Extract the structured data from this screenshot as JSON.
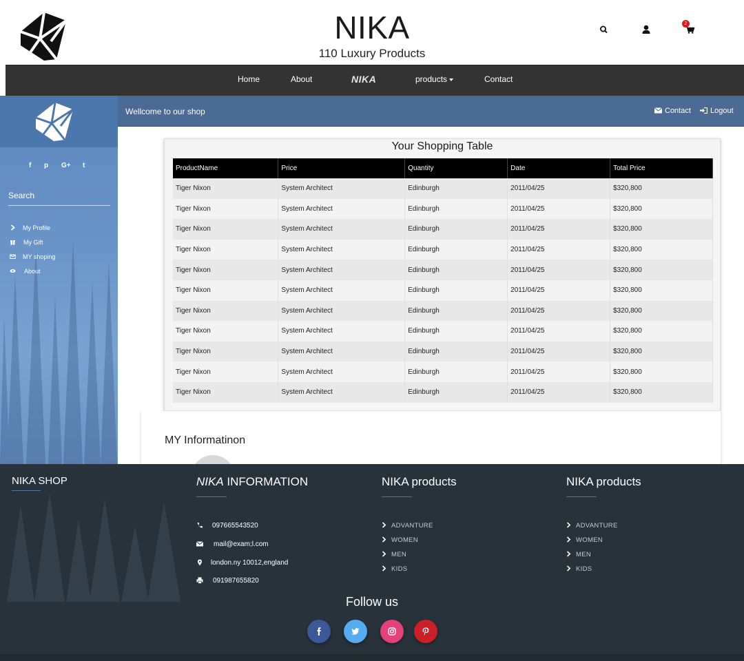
{
  "header": {
    "brand_title": "NIKA",
    "brand_subtitle": "110 Luxury Products",
    "cart_count": "2",
    "icons": [
      "logo-icon",
      "search-icon",
      "user-icon",
      "cart-icon"
    ]
  },
  "nav": {
    "items": [
      "Home",
      "About",
      "NIKA",
      "products",
      "Contact"
    ]
  },
  "sidebar": {
    "social": [
      "f",
      "p",
      "G+",
      "t"
    ],
    "search_label": "Search",
    "menu": [
      {
        "label": "My Profile",
        "icon": "chevron-right-icon"
      },
      {
        "label": "My Gift",
        "icon": "gift-icon"
      },
      {
        "label": "MY shoping",
        "icon": "envelope-icon"
      },
      {
        "label": "About",
        "icon": "eye-icon"
      }
    ]
  },
  "welcome": {
    "text": "Wellcome to our shop",
    "contact": "Contact",
    "logout": "Logout"
  },
  "table": {
    "title": "Your Shopping Table",
    "headers": [
      "ProductName",
      "Price",
      "Quantity",
      "Date",
      "Total Price"
    ],
    "rows": [
      [
        "Tiger Nixon",
        "System Architect",
        "Edinburgh",
        "2011/04/25",
        "$320,800"
      ],
      [
        "Tiger Nixon",
        "System Architect",
        "Edinburgh",
        "2011/04/25",
        "$320,800"
      ],
      [
        "Tiger Nixon",
        "System Architect",
        "Edinburgh",
        "2011/04/25",
        "$320,800"
      ],
      [
        "Tiger Nixon",
        "System Architect",
        "Edinburgh",
        "2011/04/25",
        "$320,800"
      ],
      [
        "Tiger Nixon",
        "System Architect",
        "Edinburgh",
        "2011/04/25",
        "$320,800"
      ],
      [
        "Tiger Nixon",
        "System Architect",
        "Edinburgh",
        "2011/04/25",
        "$320,800"
      ],
      [
        "Tiger Nixon",
        "System Architect",
        "Edinburgh",
        "2011/04/25",
        "$320,800"
      ],
      [
        "Tiger Nixon",
        "System Architect",
        "Edinburgh",
        "2011/04/25",
        "$320,800"
      ],
      [
        "Tiger Nixon",
        "System Architect",
        "Edinburgh",
        "2011/04/25",
        "$320,800"
      ],
      [
        "Tiger Nixon",
        "System Architect",
        "Edinburgh",
        "2011/04/25",
        "$320,800"
      ],
      [
        "Tiger Nixon",
        "System Architect",
        "Edinburgh",
        "2011/04/25",
        "$320,800"
      ]
    ]
  },
  "info": {
    "title": "MY Informatinon"
  },
  "footer": {
    "col1_title": "NIKA SHOP",
    "col2_title_brand": "NIKA",
    "col2_title_rest": " INFORMATION",
    "contacts": [
      {
        "icon": "phone-icon",
        "text": "097665543520"
      },
      {
        "icon": "envelope-icon",
        "text": "mail@exam;l.com"
      },
      {
        "icon": "map-marker-icon",
        "text": "london.ny 10012,england"
      },
      {
        "icon": "print-icon",
        "text": "091987655820"
      }
    ],
    "col3_title": "NIKA products",
    "col3_links": [
      "ADVANTURE",
      "WOMEN",
      "MEN",
      "KIDS"
    ],
    "col4_title": "NIKA products",
    "col4_links": [
      "ADVANTURE",
      "WOMEN",
      "MEN",
      "KIDS"
    ],
    "follow_title": "Follow us",
    "social_buttons": [
      {
        "icon": "facebook-icon",
        "color": "#3b5998"
      },
      {
        "icon": "twitter-icon",
        "color": "#55acee"
      },
      {
        "icon": "instagram-icon",
        "color": "#e4407a"
      },
      {
        "icon": "pinterest-icon",
        "color": "#cb2027"
      }
    ]
  }
}
